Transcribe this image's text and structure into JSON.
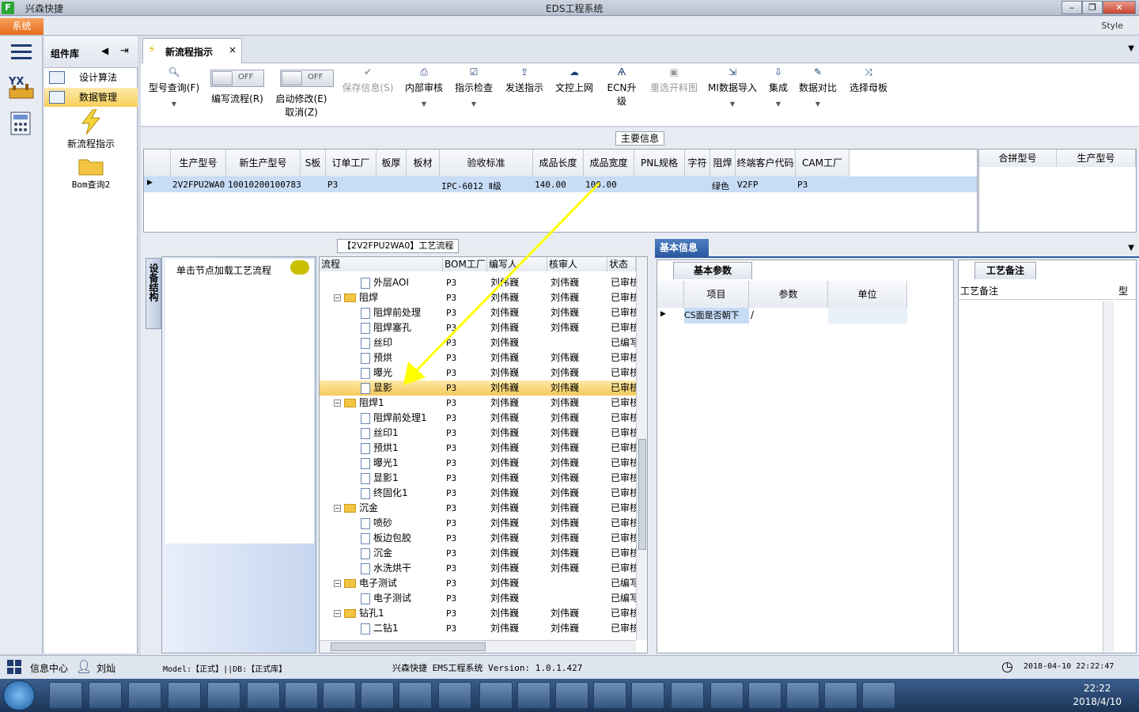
{
  "app": {
    "name": "兴森快捷",
    "window_title": "EDS工程系统",
    "win_min": "–",
    "win_max": "❐",
    "win_close": "✕"
  },
  "menu": {
    "system": "系统",
    "style": "Style"
  },
  "complib": {
    "title": "组件库",
    "items": [
      {
        "label": "设计算法"
      },
      {
        "label": "数据管理"
      }
    ],
    "big_items": [
      {
        "label": "新流程指示"
      },
      {
        "label": "Bom查询2"
      }
    ]
  },
  "tab": {
    "label": "新流程指示",
    "close": "×"
  },
  "toolbar": {
    "type_query": "型号查询(F)",
    "edit_flow": "编写流程(R)",
    "enable_edit": "启动修改(E)",
    "cancel": "取消(Z)",
    "toggle_off": "OFF",
    "save_info": "保存信息(S)",
    "internal_review": "内部审核",
    "check_instr": "指示检查",
    "send_instr": "发送指示",
    "upload_doc": "文控上网",
    "ecn_upgrade": "ECN升级",
    "reselect": "重选开料图",
    "mi_import": "MI数据导入",
    "integrate": "集成",
    "data_compare": "数据对比",
    "select_master": "选择母板"
  },
  "main_info": {
    "section_title": "主要信息",
    "columns": [
      "生产型号",
      "新生产型号",
      "S板",
      "订单工厂",
      "板厚",
      "板材",
      "验收标准",
      "成品长度",
      "成品宽度",
      "PNL规格",
      "字符",
      "阻焊",
      "终端客户代码",
      "CAM工厂"
    ],
    "row": [
      "2V2FPU2WA0",
      "10010200100783",
      "",
      "P3",
      "",
      "",
      "IPC-6012 Ⅱ级",
      "140.00",
      "100.00",
      "",
      "",
      "绿色",
      "V2FP",
      "P3"
    ],
    "side_columns": [
      "合拼型号",
      "生产型号"
    ]
  },
  "process": {
    "section_title": "【2V2FPU2WA0】工艺流程",
    "side_tab": "设备结构",
    "load_hint": "单击节点加载工艺流程",
    "columns": [
      "流程",
      "BOM工厂",
      "编写人",
      "核审人",
      "状态"
    ],
    "rows": [
      {
        "name": "外层AOI",
        "lvl": 2,
        "bom": "P3",
        "writer": "刘伟巍",
        "reviewer": "刘伟巍",
        "status": "已审核"
      },
      {
        "name": "阻焊",
        "lvl": 1,
        "bom": "P3",
        "writer": "刘伟巍",
        "reviewer": "刘伟巍",
        "status": "已审核"
      },
      {
        "name": "阻焊前处理",
        "lvl": 2,
        "bom": "P3",
        "writer": "刘伟巍",
        "reviewer": "刘伟巍",
        "status": "已审核"
      },
      {
        "name": "阻焊塞孔",
        "lvl": 2,
        "bom": "P3",
        "writer": "刘伟巍",
        "reviewer": "刘伟巍",
        "status": "已审核"
      },
      {
        "name": "丝印",
        "lvl": 2,
        "bom": "P3",
        "writer": "刘伟巍",
        "reviewer": "",
        "status": "已编写"
      },
      {
        "name": "预烘",
        "lvl": 2,
        "bom": "P3",
        "writer": "刘伟巍",
        "reviewer": "刘伟巍",
        "status": "已审核"
      },
      {
        "name": "曝光",
        "lvl": 2,
        "bom": "P3",
        "writer": "刘伟巍",
        "reviewer": "刘伟巍",
        "status": "已审核"
      },
      {
        "name": "显影",
        "lvl": 2,
        "bom": "P3",
        "writer": "刘伟巍",
        "reviewer": "刘伟巍",
        "status": "已审核"
      },
      {
        "name": "阻焊1",
        "lvl": 1,
        "bom": "P3",
        "writer": "刘伟巍",
        "reviewer": "刘伟巍",
        "status": "已审核"
      },
      {
        "name": "阻焊前处理1",
        "lvl": 2,
        "bom": "P3",
        "writer": "刘伟巍",
        "reviewer": "刘伟巍",
        "status": "已审核"
      },
      {
        "name": "丝印1",
        "lvl": 2,
        "bom": "P3",
        "writer": "刘伟巍",
        "reviewer": "刘伟巍",
        "status": "已审核"
      },
      {
        "name": "预烘1",
        "lvl": 2,
        "bom": "P3",
        "writer": "刘伟巍",
        "reviewer": "刘伟巍",
        "status": "已审核"
      },
      {
        "name": "曝光1",
        "lvl": 2,
        "bom": "P3",
        "writer": "刘伟巍",
        "reviewer": "刘伟巍",
        "status": "已审核"
      },
      {
        "name": "显影1",
        "lvl": 2,
        "bom": "P3",
        "writer": "刘伟巍",
        "reviewer": "刘伟巍",
        "status": "已审核"
      },
      {
        "name": "终固化1",
        "lvl": 2,
        "bom": "P3",
        "writer": "刘伟巍",
        "reviewer": "刘伟巍",
        "status": "已审核"
      },
      {
        "name": "沉金",
        "lvl": 1,
        "bom": "P3",
        "writer": "刘伟巍",
        "reviewer": "刘伟巍",
        "status": "已审核"
      },
      {
        "name": "喷砂",
        "lvl": 2,
        "bom": "P3",
        "writer": "刘伟巍",
        "reviewer": "刘伟巍",
        "status": "已审核"
      },
      {
        "name": "板边包胶",
        "lvl": 2,
        "bom": "P3",
        "writer": "刘伟巍",
        "reviewer": "刘伟巍",
        "status": "已审核"
      },
      {
        "name": "沉金",
        "lvl": 2,
        "bom": "P3",
        "writer": "刘伟巍",
        "reviewer": "刘伟巍",
        "status": "已审核"
      },
      {
        "name": "水洗烘干",
        "lvl": 2,
        "bom": "P3",
        "writer": "刘伟巍",
        "reviewer": "刘伟巍",
        "status": "已审核"
      },
      {
        "name": "电子测试",
        "lvl": 1,
        "bom": "P3",
        "writer": "刘伟巍",
        "reviewer": "",
        "status": "已编写"
      },
      {
        "name": "电子测试",
        "lvl": 2,
        "bom": "P3",
        "writer": "刘伟巍",
        "reviewer": "",
        "status": "已编写"
      },
      {
        "name": "钻孔1",
        "lvl": 1,
        "bom": "P3",
        "writer": "刘伟巍",
        "reviewer": "刘伟巍",
        "status": "已审核"
      },
      {
        "name": "二钻1",
        "lvl": 2,
        "bom": "P3",
        "writer": "刘伟巍",
        "reviewer": "刘伟巍",
        "status": "已审核"
      }
    ],
    "selected_index": 7
  },
  "basic_info": {
    "tab": "基本信息",
    "sub_tab": "基本参数",
    "columns": [
      "项目",
      "参数",
      "单位"
    ],
    "row": [
      "CS面是否朝下",
      "/",
      ""
    ]
  },
  "notes": {
    "tab": "工艺备注",
    "col1": "工艺备注",
    "col2": "型"
  },
  "status": {
    "info_center": "信息中心",
    "user": "刘灿",
    "model": "Model:【正式】||DB:【正式库】",
    "version": "兴森快捷 EMS工程系统 Version: 1.0.1.427",
    "datetime": "2018-04-10 22:22:47"
  },
  "taskbar": {
    "time": "22:22",
    "date": "2018/4/10"
  }
}
